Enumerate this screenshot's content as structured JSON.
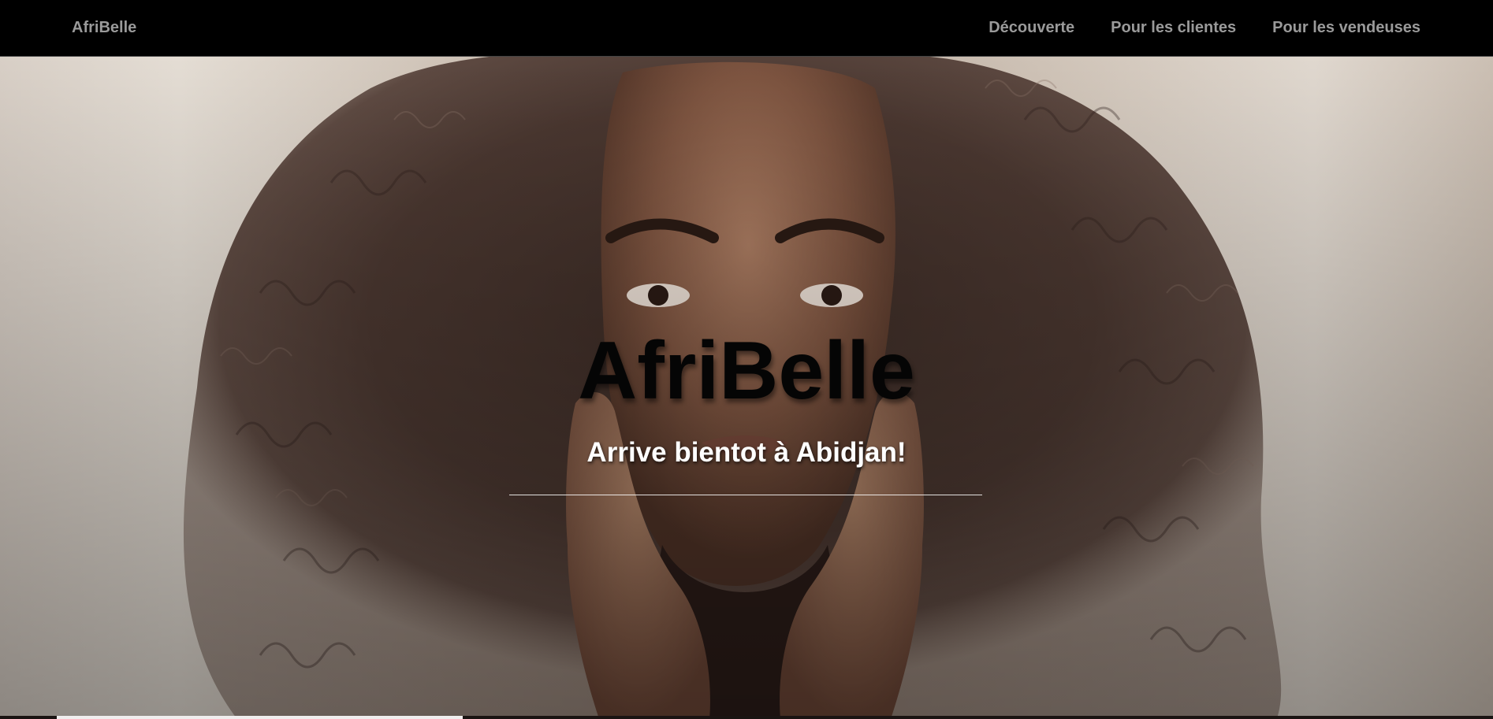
{
  "navbar": {
    "brand": "AfriBelle",
    "links": [
      {
        "label": "Découverte"
      },
      {
        "label": "Pour les clientes"
      },
      {
        "label": "Pour les vendeuses"
      }
    ]
  },
  "hero": {
    "title": "AfriBelle",
    "subtitle": "Arrive bientot à Abidjan!",
    "image_icon": "portrait-photo"
  },
  "colors": {
    "navbar_bg": "#000000",
    "nav_text": "#9a9a9a",
    "title_text": "#050505",
    "subtitle_text": "#ffffff"
  }
}
